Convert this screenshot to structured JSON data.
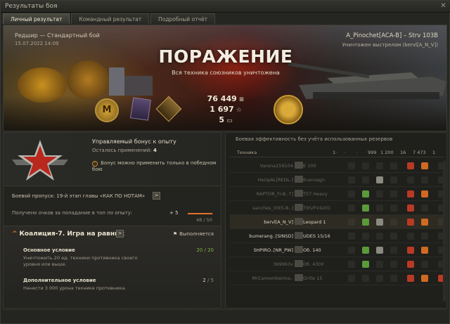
{
  "window": {
    "title": "Результаты боя",
    "close_glyph": "✕"
  },
  "tabs": [
    {
      "label": "Личный результат",
      "active": true
    },
    {
      "label": "Командный результат",
      "active": false
    },
    {
      "label": "Подробный отчёт",
      "active": false
    }
  ],
  "hero": {
    "map": "Редшир — Стандартный бой",
    "date": "15.07.2022 14:09",
    "player": "A_Pinochet[ACA-B] – Strv 103B",
    "killed_by": "Уничтожен выстрелом (bervl[A_N_V])",
    "result": "ПОРАЖЕНИЕ",
    "subresult": "Вся техника союзников уничтожена",
    "credits": "76 449",
    "credits_icon": "credits-icon",
    "xp": "1 697",
    "xp_icon": "☆",
    "free_xp": "5",
    "free_xp_icon": "free-xp-icon",
    "medal_letter": "M"
  },
  "bonus": {
    "title": "Управляемый бонус к опыту",
    "remaining_label": "Осталось применений:",
    "remaining_value": "4",
    "warning_icon": "!",
    "note": "Бонус можно применить только в победном бою"
  },
  "battlepass": {
    "line": "Боевой пропуск: 19-й этап главы «КАК ПО НОТАМ»",
    "btn": ">",
    "points_label": "Получено очков за попадание в топ по опыту:",
    "plus": "+ 5",
    "progress_fraction": 0.96,
    "count": "48 / 50"
  },
  "coalition": {
    "chevron": "^",
    "title": "Коалиция-7. Игра на равных",
    "btn": ">",
    "status": "Выполняется",
    "status_flag": "⚑",
    "conditions": [
      {
        "title": "Основное условие",
        "desc": "Уничтожить 20 ед. техники противника своего уровня или выше.",
        "value_a": "20",
        "value_b": "/ 20",
        "state": "done"
      },
      {
        "title": "Дополнительное условие",
        "desc": "Нанести 3 000 урона технике противника.",
        "value_a": "2",
        "value_b": "/ 5",
        "state": "progress"
      }
    ]
  },
  "efficiency": {
    "header": "Боевая эффективность без учёта использованных резервов",
    "columns": [
      "Техника",
      "1·",
      "·",
      "·",
      "999",
      "1 200",
      "16",
      "7 473",
      "1"
    ],
    "rows": [
      {
        "name": "Varena159104",
        "tank": "E 100",
        "state": "dead",
        "ind": [
          "none",
          "none",
          "none",
          "none",
          "red",
          "orange",
          "none"
        ]
      },
      {
        "name": "HeUpAL[REDL-]",
        "tank": "Kranvagn",
        "state": "dead",
        "ind": [
          "none",
          "none",
          "gray",
          "none",
          "none",
          "none",
          "none"
        ]
      },
      {
        "name": "RAPTOR_FI-B..T]",
        "tank": "T57 Heavy",
        "state": "dead",
        "ind": [
          "none",
          "green",
          "none",
          "none",
          "red",
          "orange",
          "none"
        ]
      },
      {
        "name": "sanches_00[S-B..]",
        "tank": "T95/FV4201",
        "state": "dead",
        "ind": [
          "none",
          "green",
          "none",
          "none",
          "red",
          "none",
          "none"
        ]
      },
      {
        "name": "bervl[A_N_V]",
        "tank": "Leopard 1",
        "state": "alive",
        "ind": [
          "none",
          "green",
          "gray",
          "none",
          "red",
          "orange",
          "none"
        ]
      },
      {
        "name": "bumerang..[SINSD]",
        "tank": "UDES 15/16",
        "state": "alive",
        "ind": [
          "none",
          "none",
          "none",
          "none",
          "none",
          "none",
          "none"
        ]
      },
      {
        "name": "SHPIRO..[NR_PW]",
        "tank": "Об. 140",
        "state": "alive",
        "ind": [
          "none",
          "green",
          "gray",
          "none",
          "red",
          "orange",
          "none"
        ]
      },
      {
        "name": "369963v",
        "tank": "Об. 430У",
        "state": "dead",
        "ind": [
          "none",
          "green",
          "none",
          "none",
          "red",
          "none",
          "none"
        ]
      },
      {
        "name": "MrCamemberma..",
        "tank": "Grille 15",
        "state": "dead",
        "ind": [
          "none",
          "none",
          "none",
          "none",
          "red",
          "orange",
          "red"
        ]
      }
    ]
  },
  "colors": {
    "accent": "#e07a2a",
    "ok": "#7fb347",
    "red_badge": "#b83a25",
    "orange_badge": "#d06a22",
    "green_badge": "#5a9a3a",
    "gray_badge": "#8a8a80"
  }
}
